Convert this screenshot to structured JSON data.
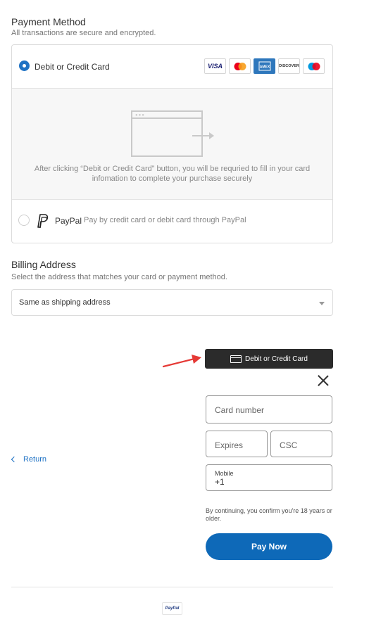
{
  "payment_method": {
    "title": "Payment Method",
    "subtitle": "All transactions are secure and encrypted.",
    "options": [
      {
        "label": "Debit or Credit Card",
        "selected": true
      },
      {
        "label": "PayPal",
        "description": "Pay by credit card or debit card through PayPal",
        "selected": false
      }
    ],
    "card_logos": [
      "VISA",
      "mastercard",
      "AMERICAN EXPRESS",
      "DISCOVER",
      "maestro"
    ],
    "panel_note": "After clicking “Debit or Credit Card” button, you will be requried to fill in your card infomation to complete your purchase securely"
  },
  "billing": {
    "title": "Billing Address",
    "subtitle": "Select the address that matches your card or payment method.",
    "selected": "Same as shipping address"
  },
  "card_form": {
    "header_button": "Debit or Credit Card",
    "card_number_placeholder": "Card number",
    "expires_placeholder": "Expires",
    "csc_placeholder": "CSC",
    "mobile_label": "Mobile",
    "mobile_value": "+1",
    "fine_print": "By continuing, you confirm you're 18 years or older.",
    "pay_button": "Pay Now"
  },
  "return_link": "Return",
  "footer_logo": "PayPal",
  "colors": {
    "accent": "#1f72c4",
    "pay_button": "#0e69b8",
    "dark_button": "#2b2b2b",
    "annotation_arrow": "#e53935"
  }
}
